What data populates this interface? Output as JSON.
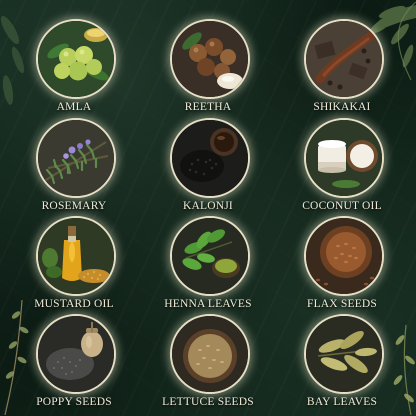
{
  "ingredients": [
    {
      "label": "AMLA",
      "icon": "amla-icon"
    },
    {
      "label": "REETHA",
      "icon": "reetha-icon"
    },
    {
      "label": "SHIKAKAI",
      "icon": "shikakai-icon"
    },
    {
      "label": "ROSEMARY",
      "icon": "rosemary-icon"
    },
    {
      "label": "KALONJI",
      "icon": "kalonji-icon"
    },
    {
      "label": "COCONUT OIL",
      "icon": "coconut-oil-icon"
    },
    {
      "label": "MUSTARD OIL",
      "icon": "mustard-oil-icon"
    },
    {
      "label": "HENNA LEAVES",
      "icon": "henna-leaves-icon"
    },
    {
      "label": "FLAX SEEDS",
      "icon": "flax-seeds-icon"
    },
    {
      "label": "POPPY SEEDS",
      "icon": "poppy-seeds-icon"
    },
    {
      "label": "LETTUCE SEEDS",
      "icon": "lettuce-seeds-icon"
    },
    {
      "label": "BAY LEAVES",
      "icon": "bay-leaves-icon"
    }
  ],
  "colors": {
    "background": "#0f2218",
    "ring": "#e6dfc5",
    "label_text": "#f1ead8"
  }
}
